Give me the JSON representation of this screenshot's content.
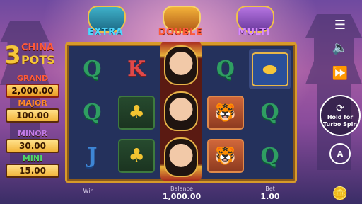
{
  "game": {
    "logo": {
      "three": "3",
      "china": "CHINA",
      "pots": "POTS"
    },
    "pots": [
      {
        "label": "EXTRA"
      },
      {
        "label": "DOUBLE"
      },
      {
        "label": "MULTI"
      }
    ],
    "jackpots": {
      "grand": {
        "label": "GRAND",
        "value": "2,000.00"
      },
      "major": {
        "label": "MAJOR",
        "value": "100.00"
      },
      "minor": {
        "label": "MINOR",
        "value": "30.00"
      },
      "mini": {
        "label": "MINI",
        "value": "15.00"
      }
    },
    "reels": {
      "symbols": [
        [
          "Q",
          "tree",
          "J"
        ],
        [
          "K",
          "tree",
          "tree"
        ],
        [
          "wild",
          "wild",
          "wild"
        ],
        [
          "Q",
          "tiger",
          "tiger"
        ],
        [
          "ingot",
          "Q",
          "Q"
        ]
      ],
      "letters": {
        "r1c1": "Q",
        "r1c2": "K",
        "r1c4": "Q",
        "r2c1": "Q",
        "r2c5": "Q",
        "r3c1": "J",
        "r3c5": "Q"
      }
    },
    "controls": {
      "spin_hint": "Hold for Turbo Spin",
      "auto_label": "A"
    },
    "status": {
      "win_label": "Win",
      "balance_label": "Balance",
      "balance_value": "1,000.00",
      "bet_label": "Bet",
      "bet_value": "1.00"
    },
    "colors": {
      "reel_frame": "#d79a2a",
      "reel_bg": "#24315c",
      "extra": "#4fd8ff",
      "double": "#ff5a3a",
      "multi": "#d98bff"
    }
  }
}
